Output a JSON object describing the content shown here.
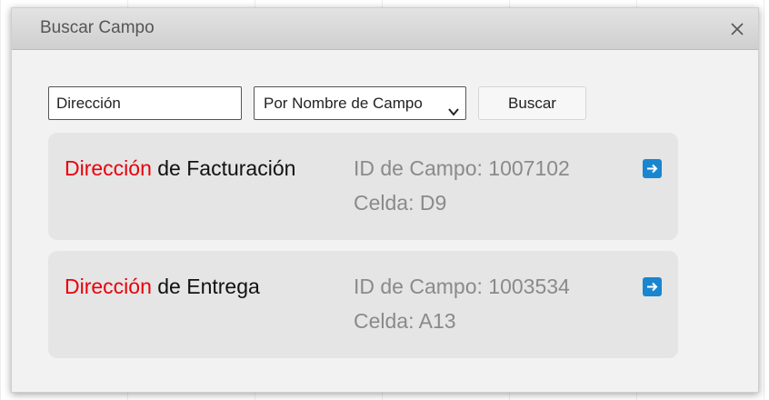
{
  "dialog": {
    "title": "Buscar Campo",
    "close_label": "close"
  },
  "search": {
    "query": "Dirección",
    "mode_selected": "Por Nombre de Campo",
    "button_label": "Buscar"
  },
  "colors": {
    "highlight": "#e8000b",
    "goto_icon": "#1a86d0",
    "card_bg": "#e5e5e5"
  },
  "results": [
    {
      "match": "Dirección",
      "rest": " de Facturación",
      "field_id": "ID de Campo: 1007102",
      "cell": "Celda: D9",
      "icon": "arrow-right-icon"
    },
    {
      "match": "Dirección",
      "rest": " de Entrega",
      "field_id": "ID de Campo: 1003534",
      "cell": "Celda: A13",
      "icon": "arrow-right-icon"
    }
  ]
}
